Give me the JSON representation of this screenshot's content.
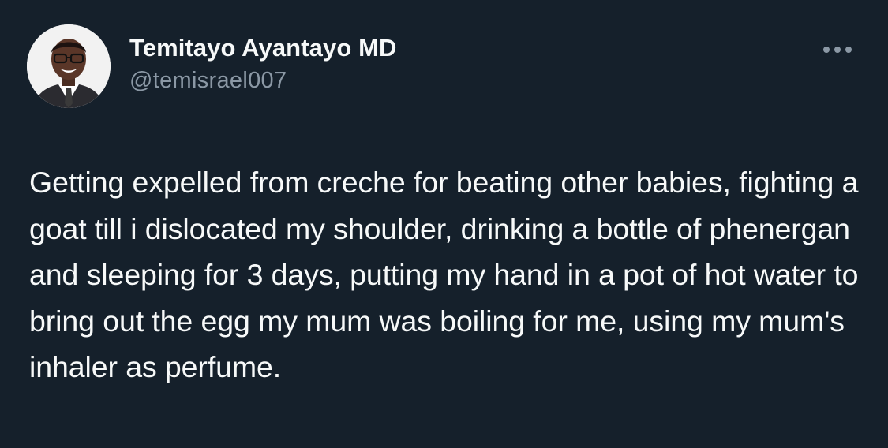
{
  "author": {
    "display_name": "Temitayo Ayantayo MD",
    "handle": "@temisrael007",
    "avatar_icon": "profile-photo"
  },
  "menu": {
    "icon": "more-horizontal-icon"
  },
  "tweet": {
    "text": "Getting expelled from creche for beating other babies, fighting a goat till i dislocated my shoulder, drinking a bottle of phenergan and sleeping for 3 days, putting my hand in a pot of hot water to bring out the egg my mum was boiling for me, using my mum's inhaler as perfume."
  },
  "colors": {
    "background": "#15202b",
    "primary_text": "#f7f9f9",
    "secondary_text": "#8b98a5"
  }
}
